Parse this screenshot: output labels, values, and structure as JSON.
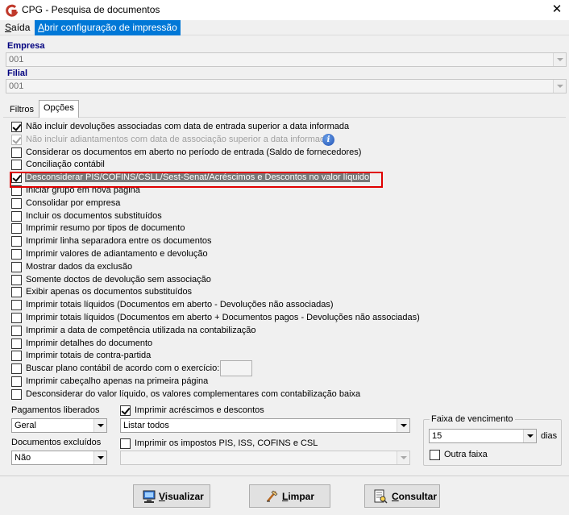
{
  "window": {
    "title": "CPG - Pesquisa de documentos",
    "close_glyph": "✕"
  },
  "menu": [
    {
      "label": "Saída",
      "accel": "S",
      "rest": "aída"
    },
    {
      "label": "Abrir configuração de impressão",
      "accel": "A",
      "rest": "brir configuração de impressão"
    }
  ],
  "empresa": {
    "label": "Empresa",
    "value": "001"
  },
  "filial": {
    "label": "Filial",
    "value": "001"
  },
  "tabs": [
    {
      "label": "Filtros"
    },
    {
      "label": "Opções"
    }
  ],
  "options": [
    {
      "label": "Não incluir devoluções associadas com data de entrada superior a data informada",
      "checked": true
    },
    {
      "label": "Não incluir adiantamentos com data de associação superior a data informada",
      "checked": true,
      "disabled": true
    },
    {
      "label": "Considerar os documentos em aberto no período de entrada (Saldo de fornecedores)",
      "checked": false
    },
    {
      "label": "Conciliação contábil",
      "checked": false
    },
    {
      "label": "Desconsiderar PIS/COFINS/CSLL/Sest-Senat/Acréscimos e Descontos no valor líquido",
      "checked": true,
      "highlighted": true
    },
    {
      "label": "Iniciar grupo em nova página",
      "checked": false
    },
    {
      "label": "Consolidar por empresa",
      "checked": false
    },
    {
      "label": "Incluir os documentos substituídos",
      "checked": false
    },
    {
      "label": "Imprimir resumo por tipos de documento",
      "checked": false
    },
    {
      "label": "Imprimir linha separadora entre os documentos",
      "checked": false
    },
    {
      "label": "Imprimir valores de adiantamento e devolução",
      "checked": false
    },
    {
      "label": "Mostrar dados da exclusão",
      "checked": false
    },
    {
      "label": "Somente doctos de devolução sem associação",
      "checked": false
    },
    {
      "label": "Exibir apenas os documentos substituídos",
      "checked": false
    },
    {
      "label": "Imprimir totais líquidos (Documentos em aberto - Devoluções não associadas)",
      "checked": false
    },
    {
      "label": "Imprimir totais líquidos (Documentos em aberto + Documentos pagos - Devoluções não associadas)",
      "checked": false
    },
    {
      "label": "Imprimir a data de competência utilizada na contabilização",
      "checked": false
    },
    {
      "label": "Imprimir detalhes do documento",
      "checked": false
    },
    {
      "label": "Imprimir totais de contra-partida",
      "checked": false
    },
    {
      "label": "Buscar plano contábil de acordo com o exercício:",
      "checked": false,
      "has_input": true
    },
    {
      "label": "Imprimir cabeçalho apenas na primeira página",
      "checked": false
    },
    {
      "label": "Desconsiderar do valor líquido, os valores complementares com contabilização baixa",
      "checked": false
    }
  ],
  "pagamentos_liberados": {
    "label": "Pagamentos liberados",
    "value": "Geral"
  },
  "documentos_excluidos": {
    "label": "Documentos excluídos",
    "value": "Não"
  },
  "acrescimos": {
    "label": "Imprimir acréscimos e descontos",
    "checked": true,
    "value": "Listar todos"
  },
  "impostos": {
    "label": "Imprimir os impostos PIS, ISS, COFINS e CSL",
    "checked": false,
    "value": ""
  },
  "faixa": {
    "title": "Faixa de vencimento",
    "value": "15",
    "unit": "dias",
    "outra_label": "Outra faixa",
    "outra_checked": false
  },
  "buttons": {
    "visualizar": {
      "accel": "V",
      "rest": "isualizar"
    },
    "limpar": {
      "accel": "L",
      "rest": "impar"
    },
    "consultar": {
      "accel": "C",
      "rest": "onsultar"
    }
  },
  "colors": {
    "accent": "#0078d7",
    "label_blue": "#00007f",
    "highlight_border": "#e00000"
  }
}
